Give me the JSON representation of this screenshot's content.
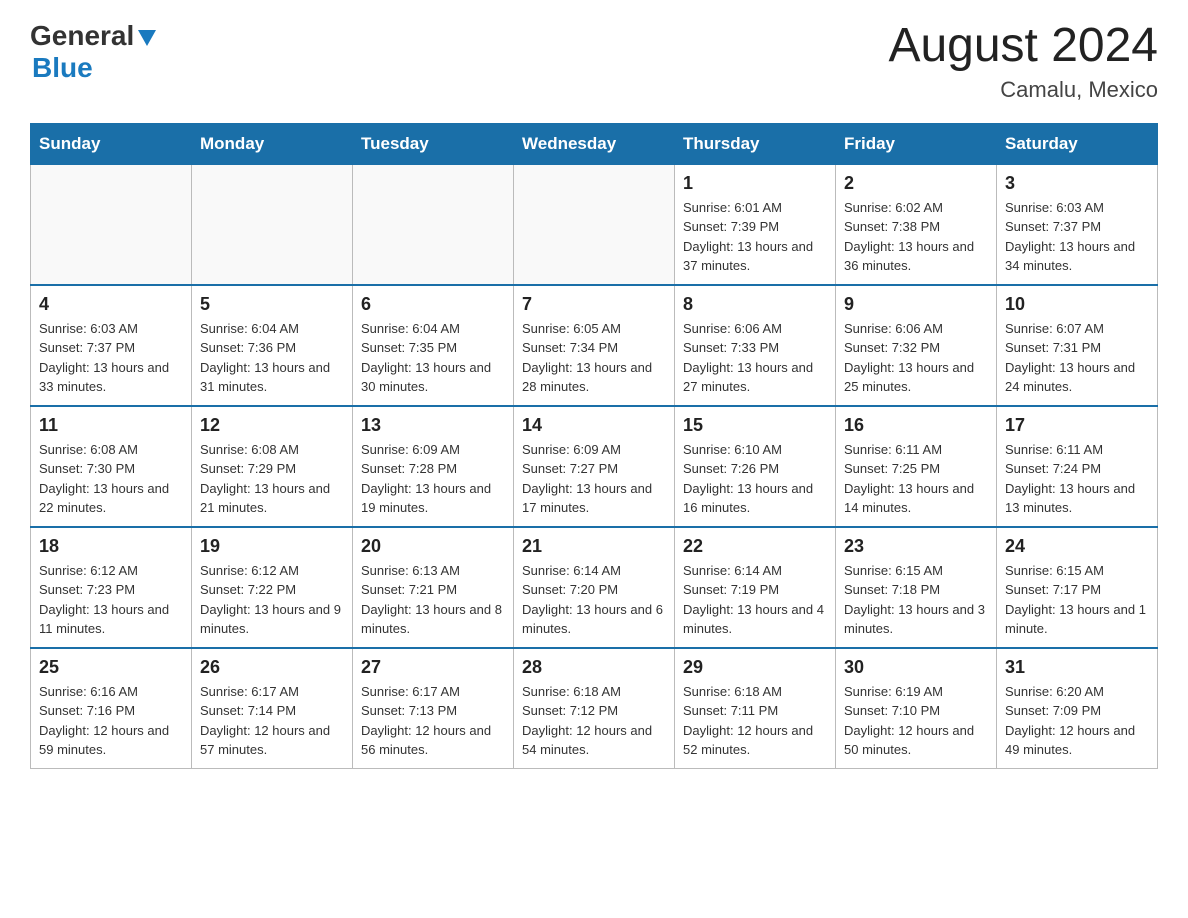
{
  "header": {
    "logo_general": "General",
    "logo_blue": "Blue",
    "month_title": "August 2024",
    "location": "Camalu, Mexico"
  },
  "weekdays": [
    "Sunday",
    "Monday",
    "Tuesday",
    "Wednesday",
    "Thursday",
    "Friday",
    "Saturday"
  ],
  "weeks": [
    [
      {
        "day": "",
        "info": ""
      },
      {
        "day": "",
        "info": ""
      },
      {
        "day": "",
        "info": ""
      },
      {
        "day": "",
        "info": ""
      },
      {
        "day": "1",
        "info": "Sunrise: 6:01 AM\nSunset: 7:39 PM\nDaylight: 13 hours and 37 minutes."
      },
      {
        "day": "2",
        "info": "Sunrise: 6:02 AM\nSunset: 7:38 PM\nDaylight: 13 hours and 36 minutes."
      },
      {
        "day": "3",
        "info": "Sunrise: 6:03 AM\nSunset: 7:37 PM\nDaylight: 13 hours and 34 minutes."
      }
    ],
    [
      {
        "day": "4",
        "info": "Sunrise: 6:03 AM\nSunset: 7:37 PM\nDaylight: 13 hours and 33 minutes."
      },
      {
        "day": "5",
        "info": "Sunrise: 6:04 AM\nSunset: 7:36 PM\nDaylight: 13 hours and 31 minutes."
      },
      {
        "day": "6",
        "info": "Sunrise: 6:04 AM\nSunset: 7:35 PM\nDaylight: 13 hours and 30 minutes."
      },
      {
        "day": "7",
        "info": "Sunrise: 6:05 AM\nSunset: 7:34 PM\nDaylight: 13 hours and 28 minutes."
      },
      {
        "day": "8",
        "info": "Sunrise: 6:06 AM\nSunset: 7:33 PM\nDaylight: 13 hours and 27 minutes."
      },
      {
        "day": "9",
        "info": "Sunrise: 6:06 AM\nSunset: 7:32 PM\nDaylight: 13 hours and 25 minutes."
      },
      {
        "day": "10",
        "info": "Sunrise: 6:07 AM\nSunset: 7:31 PM\nDaylight: 13 hours and 24 minutes."
      }
    ],
    [
      {
        "day": "11",
        "info": "Sunrise: 6:08 AM\nSunset: 7:30 PM\nDaylight: 13 hours and 22 minutes."
      },
      {
        "day": "12",
        "info": "Sunrise: 6:08 AM\nSunset: 7:29 PM\nDaylight: 13 hours and 21 minutes."
      },
      {
        "day": "13",
        "info": "Sunrise: 6:09 AM\nSunset: 7:28 PM\nDaylight: 13 hours and 19 minutes."
      },
      {
        "day": "14",
        "info": "Sunrise: 6:09 AM\nSunset: 7:27 PM\nDaylight: 13 hours and 17 minutes."
      },
      {
        "day": "15",
        "info": "Sunrise: 6:10 AM\nSunset: 7:26 PM\nDaylight: 13 hours and 16 minutes."
      },
      {
        "day": "16",
        "info": "Sunrise: 6:11 AM\nSunset: 7:25 PM\nDaylight: 13 hours and 14 minutes."
      },
      {
        "day": "17",
        "info": "Sunrise: 6:11 AM\nSunset: 7:24 PM\nDaylight: 13 hours and 13 minutes."
      }
    ],
    [
      {
        "day": "18",
        "info": "Sunrise: 6:12 AM\nSunset: 7:23 PM\nDaylight: 13 hours and 11 minutes."
      },
      {
        "day": "19",
        "info": "Sunrise: 6:12 AM\nSunset: 7:22 PM\nDaylight: 13 hours and 9 minutes."
      },
      {
        "day": "20",
        "info": "Sunrise: 6:13 AM\nSunset: 7:21 PM\nDaylight: 13 hours and 8 minutes."
      },
      {
        "day": "21",
        "info": "Sunrise: 6:14 AM\nSunset: 7:20 PM\nDaylight: 13 hours and 6 minutes."
      },
      {
        "day": "22",
        "info": "Sunrise: 6:14 AM\nSunset: 7:19 PM\nDaylight: 13 hours and 4 minutes."
      },
      {
        "day": "23",
        "info": "Sunrise: 6:15 AM\nSunset: 7:18 PM\nDaylight: 13 hours and 3 minutes."
      },
      {
        "day": "24",
        "info": "Sunrise: 6:15 AM\nSunset: 7:17 PM\nDaylight: 13 hours and 1 minute."
      }
    ],
    [
      {
        "day": "25",
        "info": "Sunrise: 6:16 AM\nSunset: 7:16 PM\nDaylight: 12 hours and 59 minutes."
      },
      {
        "day": "26",
        "info": "Sunrise: 6:17 AM\nSunset: 7:14 PM\nDaylight: 12 hours and 57 minutes."
      },
      {
        "day": "27",
        "info": "Sunrise: 6:17 AM\nSunset: 7:13 PM\nDaylight: 12 hours and 56 minutes."
      },
      {
        "day": "28",
        "info": "Sunrise: 6:18 AM\nSunset: 7:12 PM\nDaylight: 12 hours and 54 minutes."
      },
      {
        "day": "29",
        "info": "Sunrise: 6:18 AM\nSunset: 7:11 PM\nDaylight: 12 hours and 52 minutes."
      },
      {
        "day": "30",
        "info": "Sunrise: 6:19 AM\nSunset: 7:10 PM\nDaylight: 12 hours and 50 minutes."
      },
      {
        "day": "31",
        "info": "Sunrise: 6:20 AM\nSunset: 7:09 PM\nDaylight: 12 hours and 49 minutes."
      }
    ]
  ]
}
